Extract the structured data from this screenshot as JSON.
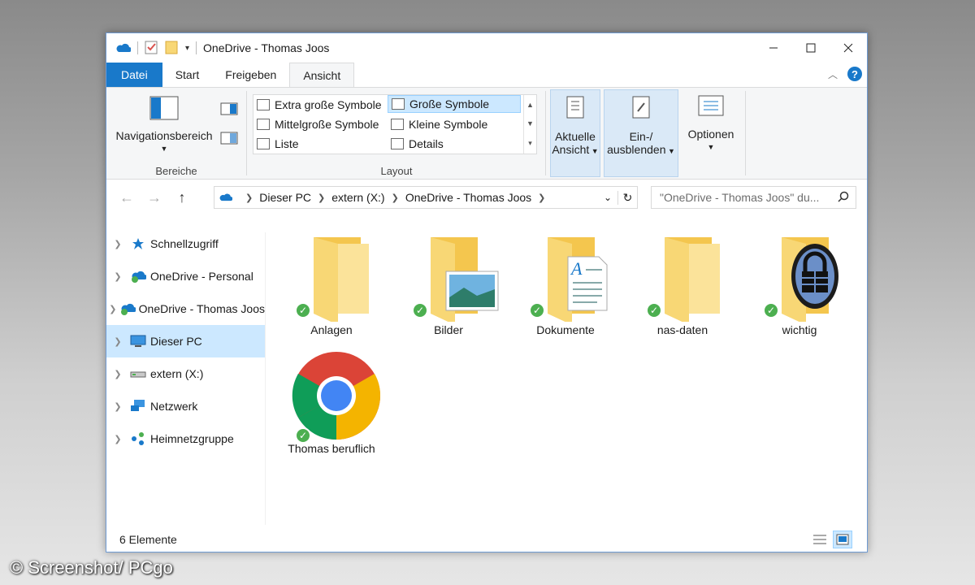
{
  "window": {
    "title": "OneDrive - Thomas Joos"
  },
  "tabs": [
    "Datei",
    "Start",
    "Freigeben",
    "Ansicht"
  ],
  "ribbon": {
    "bereiche": {
      "nav_label": "Navigationsbereich",
      "group_label": "Bereiche"
    },
    "layout": {
      "group_label": "Layout",
      "options": [
        "Extra große Symbole",
        "Große Symbole",
        "Mittelgroße Symbole",
        "Kleine Symbole",
        "Liste",
        "Details"
      ],
      "selected": "Große Symbole"
    },
    "current_view": {
      "line1": "Aktuelle",
      "line2": "Ansicht"
    },
    "show_hide": {
      "line1": "Ein-/",
      "line2": "ausblenden"
    },
    "options": {
      "label": "Optionen"
    }
  },
  "address": {
    "crumbs": [
      "Dieser PC",
      "extern (X:)",
      "OneDrive - Thomas Joos"
    ],
    "search_placeholder": "\"OneDrive - Thomas Joos\" du..."
  },
  "nav": [
    {
      "label": "Schnellzugriff",
      "icon": "star-icon"
    },
    {
      "label": "OneDrive - Personal",
      "icon": "onedrive-icon"
    },
    {
      "label": "OneDrive - Thomas Joos",
      "icon": "onedrive-icon"
    },
    {
      "label": "Dieser PC",
      "icon": "computer-icon",
      "selected": true
    },
    {
      "label": "extern (X:)",
      "icon": "drive-icon"
    },
    {
      "label": "Netzwerk",
      "icon": "network-icon"
    },
    {
      "label": "Heimnetzgruppe",
      "icon": "homegroup-icon"
    }
  ],
  "items": [
    {
      "label": "Anlagen",
      "icon": "folder-icon"
    },
    {
      "label": "Bilder",
      "icon": "pictures-folder-icon"
    },
    {
      "label": "Dokumente",
      "icon": "documents-folder-icon"
    },
    {
      "label": "nas-daten",
      "icon": "folder-icon"
    },
    {
      "label": "wichtig",
      "icon": "keepass-folder-icon"
    },
    {
      "label": "Thomas beruflich",
      "icon": "chrome-icon"
    }
  ],
  "status": {
    "count": "6 Elemente"
  },
  "credit": "© Screenshot/ PCgo",
  "colors": {
    "accent": "#1979ca",
    "selection": "#cce8ff",
    "sync_ok": "#4caf50",
    "folder": "#f8d775"
  }
}
